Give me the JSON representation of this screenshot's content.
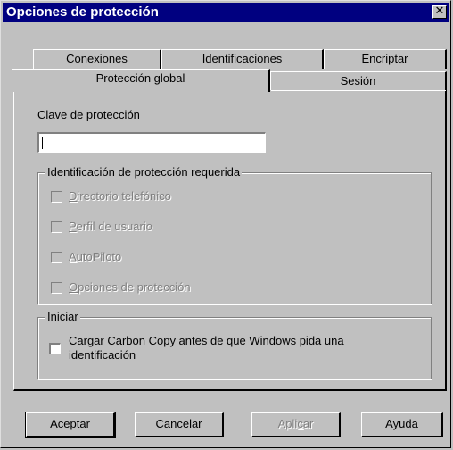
{
  "window": {
    "title": "Opciones de protección",
    "close_glyph": "✕"
  },
  "tabs_back": [
    "Conexiones",
    "Identificaciones",
    "Encriptar"
  ],
  "tabs_front": [
    "Protección global",
    "Sesión"
  ],
  "active_tab": "Protección global",
  "password": {
    "label": "Clave de protección",
    "value": ""
  },
  "required_group": {
    "title": "Identificación de protección requerida",
    "items": [
      {
        "label_first": "D",
        "label_rest": "irectorio telefónico",
        "checked": false,
        "enabled": false
      },
      {
        "label_first": "P",
        "label_rest": "erfil de usuario",
        "checked": false,
        "enabled": false
      },
      {
        "label_first": "A",
        "label_rest": "utoPiloto",
        "checked": false,
        "enabled": false
      },
      {
        "label_first": "O",
        "label_rest": "pciones de protección",
        "checked": false,
        "enabled": false
      }
    ]
  },
  "start_group": {
    "title": "Iniciar",
    "item": {
      "label_first": "C",
      "line1_rest": "argar Carbon Copy antes de que Windows pida una",
      "line2": "identificación",
      "checked": false,
      "enabled": true
    }
  },
  "buttons": {
    "ok": "Aceptar",
    "cancel": "Cancelar",
    "apply_first": "Apli",
    "apply_u": "c",
    "apply_last": "ar",
    "help": "Ayuda"
  },
  "colors": {
    "face": "#c0c0c0",
    "titlebar": "#000080",
    "disabled_text": "#808080"
  }
}
